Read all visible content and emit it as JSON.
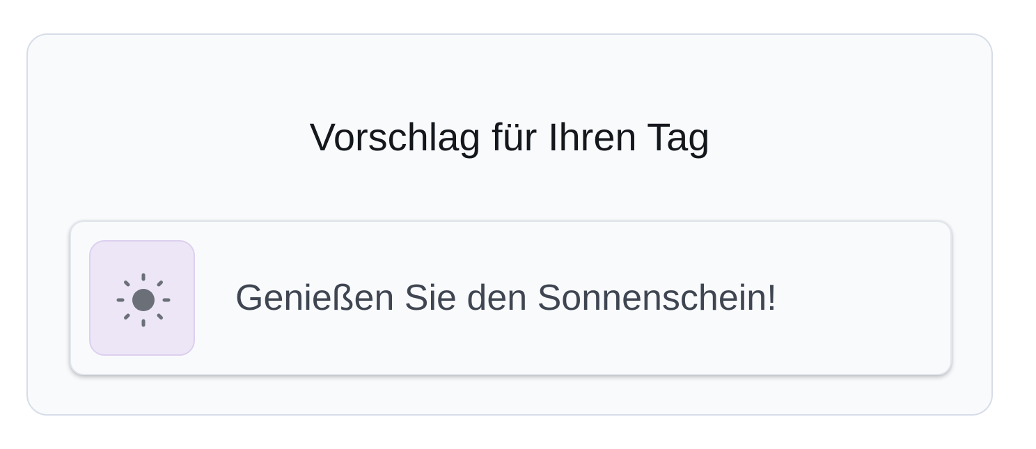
{
  "card": {
    "title": "Vorschlag für Ihren Tag"
  },
  "suggestion": {
    "icon": "sun-icon",
    "text": "Genießen Sie den Sonnenschein!"
  },
  "colors": {
    "icon_background": "#ede6f6",
    "icon_color": "#6b7078",
    "card_background": "#f8fafc",
    "card_border": "#d7dde8"
  }
}
